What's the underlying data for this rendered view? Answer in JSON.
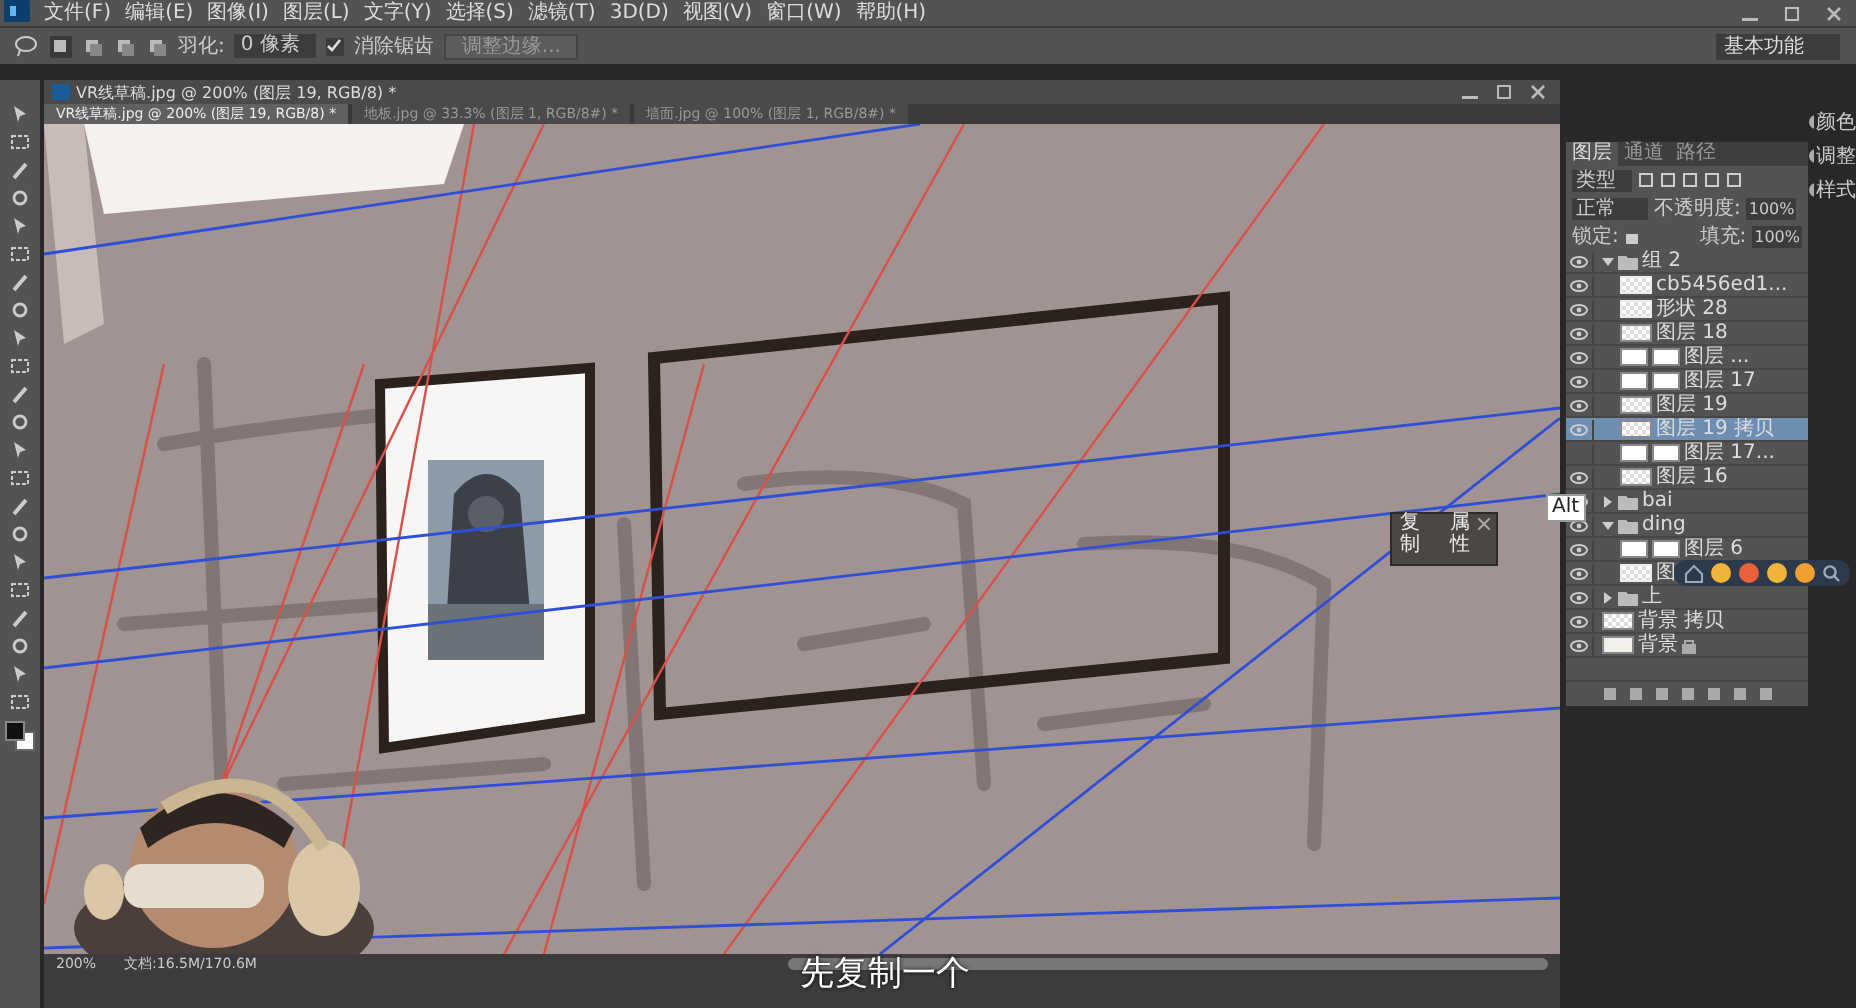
{
  "menu": [
    "文件(F)",
    "编辑(E)",
    "图像(I)",
    "图层(L)",
    "文字(Y)",
    "选择(S)",
    "滤镜(T)",
    "3D(D)",
    "视图(V)",
    "窗口(W)",
    "帮助(H)"
  ],
  "options": {
    "feather_label": "羽化:",
    "feather_value": "0 像素",
    "antialias": {
      "label": "消除锯齿",
      "checked": true
    },
    "refine_button": "调整边缘...",
    "workspace": "基本功能"
  },
  "document": {
    "title": "VR线草稿.jpg @ 200% (图层 19, RGB/8) *",
    "tabs": [
      {
        "label": "VR线草稿.jpg @ 200% (图层 19, RGB/8) *",
        "selected": true
      },
      {
        "label": "地板.jpg @ 33.3% (图层 1, RGB/8#) *",
        "selected": false
      },
      {
        "label": "墙面.jpg @ 100% (图层 1, RGB/8#) *",
        "selected": false
      }
    ],
    "zoom": "200%",
    "doc_size": "文档:16.5M/170.6M"
  },
  "layers_panel": {
    "tabs": [
      {
        "label": "图层",
        "selected": true
      },
      {
        "label": "通道",
        "selected": false
      },
      {
        "label": "路径",
        "selected": false
      }
    ],
    "filter": "类型",
    "blend_mode": "正常",
    "opacity_label": "不透明度:",
    "opacity": "100%",
    "lock_label": "锁定:",
    "fill_label": "填充:",
    "fill": "100%",
    "layers": [
      {
        "name": "组 2",
        "kind": "group",
        "visible": true,
        "selected": false,
        "expanded": true,
        "children": [
          {
            "name": "cb5456ed1...",
            "kind": "smart",
            "visible": true,
            "selected": false
          },
          {
            "name": "形状 28",
            "kind": "smart",
            "visible": true,
            "selected": false
          },
          {
            "name": "图层 18",
            "kind": "layer",
            "visible": true,
            "selected": false
          },
          {
            "name": "图层 ...",
            "kind": "mask",
            "visible": true,
            "selected": false
          },
          {
            "name": "图层 17",
            "kind": "mask",
            "visible": true,
            "selected": false
          },
          {
            "name": "图层 19",
            "kind": "layer",
            "visible": true,
            "selected": false
          },
          {
            "name": "图层 19 拷贝",
            "kind": "layer",
            "visible": true,
            "selected": true
          },
          {
            "name": "图层 17...",
            "kind": "mask",
            "visible": false,
            "selected": false
          },
          {
            "name": "图层 16",
            "kind": "layer",
            "visible": true,
            "selected": false
          }
        ]
      },
      {
        "name": "bai",
        "kind": "group",
        "visible": true,
        "selected": false,
        "expanded": false
      },
      {
        "name": "ding",
        "kind": "group",
        "visible": true,
        "selected": false,
        "expanded": true,
        "children": [
          {
            "name": "图层 6",
            "kind": "mask",
            "visible": true,
            "selected": false
          },
          {
            "name": "图",
            "kind": "smart",
            "visible": true,
            "selected": false
          }
        ]
      },
      {
        "name": "上",
        "kind": "group",
        "visible": true,
        "selected": false,
        "expanded": false
      },
      {
        "name": "背景 拷贝",
        "kind": "layer",
        "visible": true,
        "selected": false
      },
      {
        "name": "背景",
        "kind": "background",
        "visible": true,
        "selected": false
      }
    ]
  },
  "side_panels": [
    "颜色",
    "调整",
    "样式"
  ],
  "tooltip": "Alt",
  "mini_dialog": {
    "items": [
      "复制",
      "属性"
    ]
  },
  "subtitle": "先复制一个"
}
